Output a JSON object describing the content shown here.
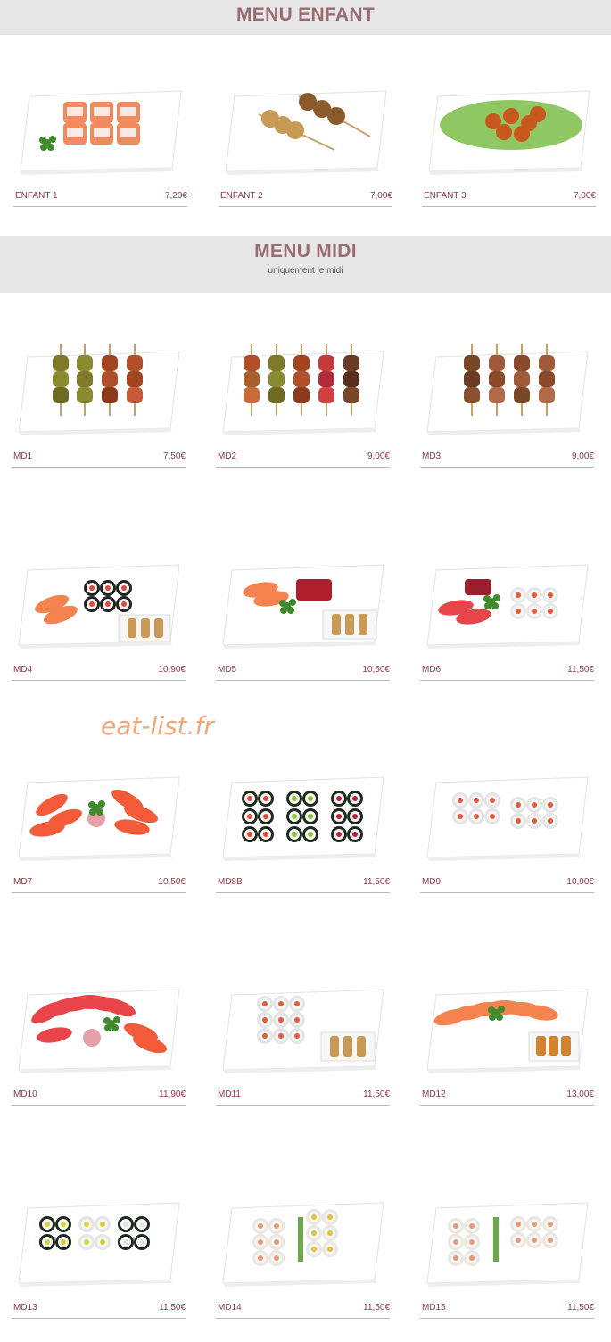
{
  "sections": {
    "enfant": {
      "title": "MENU ENFANT"
    },
    "midi": {
      "title": "MENU MIDI",
      "subtitle": "uniquement le midi"
    }
  },
  "watermark": "eat-list.fr",
  "items": [
    {
      "name": "ENFANT 1",
      "price": "7,20€",
      "dish": "salmon-maki-plate"
    },
    {
      "name": "ENFANT 2",
      "price": "7,00€",
      "dish": "yakitori-skewers"
    },
    {
      "name": "ENFANT 3",
      "price": "7,00€",
      "dish": "fried-chicken-salad"
    },
    {
      "name": "MD1",
      "price": "7,50€",
      "dish": "four-skewers"
    },
    {
      "name": "MD2",
      "price": "9,00€",
      "dish": "five-skewers"
    },
    {
      "name": "MD3",
      "price": "9,00€",
      "dish": "salmon-skewers"
    },
    {
      "name": "MD4",
      "price": "10,90€",
      "dish": "sushi-maki-skewers"
    },
    {
      "name": "MD5",
      "price": "10,50€",
      "dish": "sashimi-skewers"
    },
    {
      "name": "MD6",
      "price": "11,50€",
      "dish": "sashimi-california"
    },
    {
      "name": "MD7",
      "price": "10,50€",
      "dish": "salmon-sushi"
    },
    {
      "name": "MD8B",
      "price": "11,50€",
      "dish": "maki-trio"
    },
    {
      "name": "MD9",
      "price": "10,90€",
      "dish": "california-rolls"
    },
    {
      "name": "MD10",
      "price": "11,90€",
      "dish": "tuna-sushi-sashimi"
    },
    {
      "name": "MD11",
      "price": "11,50€",
      "dish": "california-skewers"
    },
    {
      "name": "MD12",
      "price": "13,00€",
      "dish": "salmon-sashimi"
    },
    {
      "name": "MD13",
      "price": "11,50€",
      "dish": "maki-mix"
    },
    {
      "name": "MD14",
      "price": "11,50€",
      "dish": "spring-rolls"
    },
    {
      "name": "MD15",
      "price": "11,50€",
      "dish": "spring-rolls-mix"
    }
  ]
}
